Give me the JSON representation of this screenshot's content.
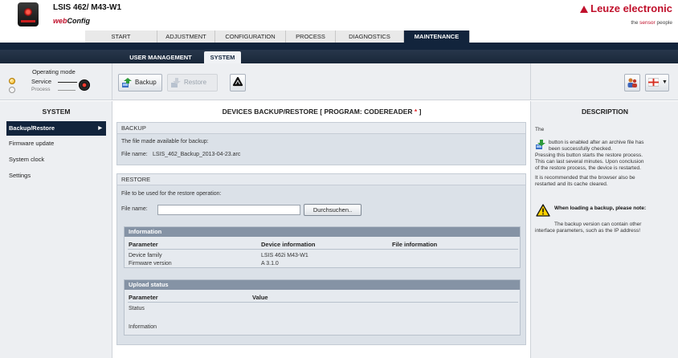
{
  "header": {
    "device_name": "LSIS 462/ M43-W1",
    "webconfig_prefix": "web",
    "webconfig_suffix": "Config",
    "brand": "Leuze electronic",
    "slogan_pre": "the ",
    "slogan_mid": "sensor",
    "slogan_post": " people"
  },
  "main_nav": {
    "tabs": [
      {
        "label": "START"
      },
      {
        "label": "ADJUSTMENT"
      },
      {
        "label": "CONFIGURATION"
      },
      {
        "label": "PROCESS"
      },
      {
        "label": "DIAGNOSTICS"
      },
      {
        "label": "MAINTENANCE",
        "active": true
      }
    ]
  },
  "sub_nav": {
    "tabs": [
      {
        "label": "USER MANAGEMENT"
      },
      {
        "label": "SYSTEM",
        "active": true
      }
    ]
  },
  "operating_mode": {
    "title": "Operating mode",
    "service": "Service",
    "process": "Process"
  },
  "toolbar": {
    "backup_label": "Backup",
    "restore_label": "Restore"
  },
  "sidebar": {
    "title": "SYSTEM",
    "items": [
      {
        "label": "Backup/Restore",
        "active": true
      },
      {
        "label": "Firmware update"
      },
      {
        "label": "System clock"
      },
      {
        "label": "Settings"
      }
    ]
  },
  "main": {
    "title": "DEVICES BACKUP/RESTORE   [ PROGRAM: CODEREADER ",
    "title_star": "*",
    "title_end": " ]",
    "backup": {
      "heading": "BACKUP",
      "text": "The file made available for backup:",
      "file_label": "File name:",
      "file_value": "LSIS_462_Backup_2013-04-23.arc"
    },
    "restore": {
      "heading": "RESTORE",
      "text": "File to be used for the restore operation:",
      "file_label": "File name:",
      "file_value": "",
      "browse_label": "Durchsuchen..",
      "information": {
        "heading": "Information",
        "columns": [
          "Parameter",
          "Device information",
          "File information"
        ],
        "rows": [
          [
            "Device family",
            "LSIS 462i M43-W1",
            ""
          ],
          [
            "Firmware version",
            "A 3.1.0",
            ""
          ]
        ]
      },
      "upload_status": {
        "heading": "Upload status",
        "columns": [
          "Parameter",
          "Value"
        ],
        "rows": [
          [
            "Status",
            ""
          ],
          [
            "Information",
            ""
          ]
        ]
      }
    }
  },
  "description": {
    "title": "DESCRIPTION",
    "p1": "The",
    "p2a": "button is enabled after an archive file has",
    "p2b": "been successfully checked.",
    "p3a": "Pressing this button starts the restore process.",
    "p3b": "This can last several minutes. Upon conclusion",
    "p3c": "of the restore process, the device is restarted.",
    "p4a": "It is recommended that the browser also be",
    "p4b": "restarted and its cache cleared.",
    "warning_title": "When loading a backup, please note:",
    "w1": "The backup version can contain other",
    "w2": "interface parameters, such as the IP address!"
  },
  "colors": {
    "navy": "#12243c",
    "brand_red": "#c0102b",
    "panel": "#dbe1e8",
    "star_red": "#e3262b"
  },
  "icons": [
    "backup-icon",
    "restore-icon",
    "recycle-icon",
    "users-icon",
    "language-flag-icon",
    "warning-icon"
  ]
}
